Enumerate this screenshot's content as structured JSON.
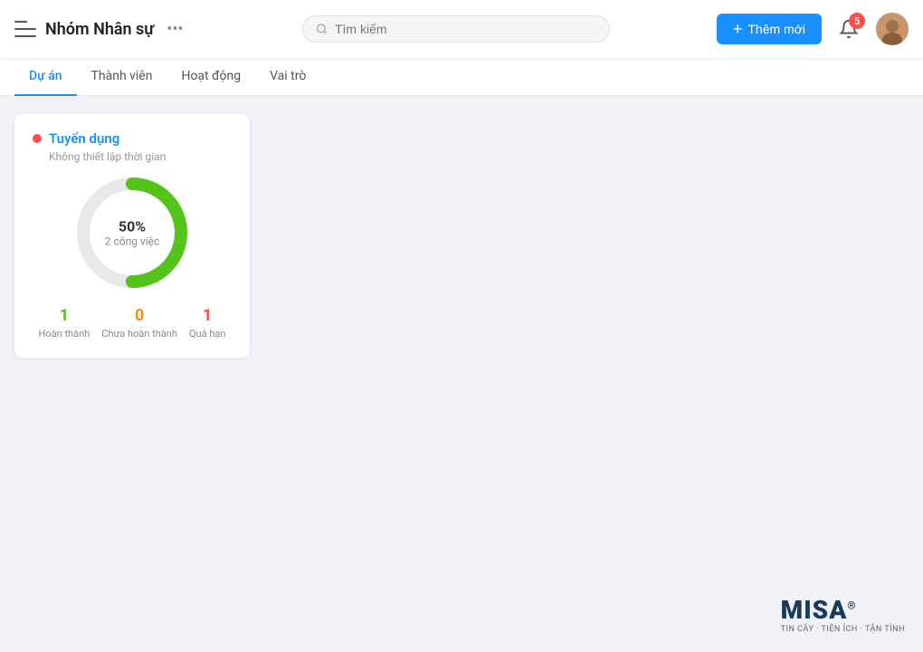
{
  "header": {
    "title": "Nhóm Nhân sự",
    "more_label": "•••",
    "search_placeholder": "Tìm kiếm",
    "add_button_label": "Thêm mới",
    "notification_count": "5"
  },
  "tabs": [
    {
      "id": "du-an",
      "label": "Dự án",
      "active": true
    },
    {
      "id": "thanh-vien",
      "label": "Thành viên",
      "active": false
    },
    {
      "id": "hoat-dong",
      "label": "Hoạt động",
      "active": false
    },
    {
      "id": "vai-tro",
      "label": "Vai trò",
      "active": false
    }
  ],
  "project_card": {
    "name": "Tuyển dụng",
    "time_label": "Không thiết lập thời gian",
    "percent": "50%",
    "jobs_label": "2 công việc",
    "donut": {
      "total_circumference": 339.3,
      "green_offset": 169.6,
      "radius": 54,
      "stroke_width": 14
    },
    "stats": [
      {
        "value": "1",
        "label": "Hoàn thành",
        "color": "green"
      },
      {
        "value": "0",
        "label": "Chưa hoàn thành",
        "color": "orange"
      },
      {
        "value": "1",
        "label": "Quá hạn",
        "color": "red"
      }
    ]
  },
  "misa": {
    "logo_text": "MISA",
    "tagline": "TIN CẬY · TIỆN ÍCH · TẬN TÌNH"
  }
}
